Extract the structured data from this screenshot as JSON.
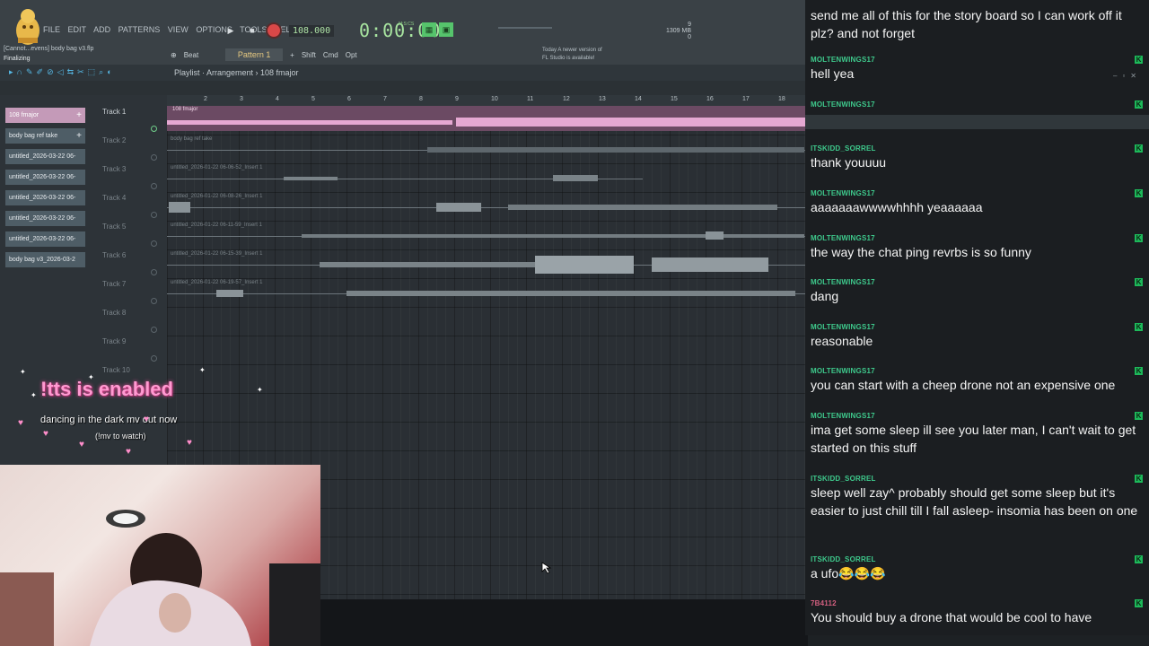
{
  "topbar": {
    "menu": [
      "File",
      "Edit",
      "Add",
      "Patterns",
      "View",
      "Options",
      "Tools",
      "Help"
    ],
    "project_title": "[Cannot...evens] body bag v3.flp",
    "status": "Finalizing",
    "tempo": "108.000",
    "song_time": "0:00:00",
    "song_time_unit": "M:S:CS",
    "memory": "1309 MB",
    "memory_sub": "0",
    "cpu_value": "9",
    "snap": "Beat",
    "pattern": "Pattern 1",
    "shift_label": "Shift",
    "cmd_label": "Cmd",
    "opt_label": "Opt",
    "update_line1": "Today  A newer version of",
    "update_line2": "FL Studio is available!"
  },
  "playlist": {
    "title": "Playlist · Arrangement › 108 fmajor",
    "ruler": [
      "2",
      "3",
      "4",
      "5",
      "6",
      "7",
      "8",
      "9",
      "10",
      "11",
      "12",
      "13",
      "14",
      "15",
      "16",
      "17",
      "18"
    ],
    "picker": [
      {
        "label": "108 fmajor",
        "selected": true
      },
      {
        "label": "body bag ref take",
        "selected": false
      },
      {
        "label": "untitled_2026-03-22 06-",
        "selected": false
      },
      {
        "label": "untitled_2026-03-22 06-",
        "selected": false
      },
      {
        "label": "untitled_2026-03-22 06-",
        "selected": false
      },
      {
        "label": "untitled_2026-03-22 06-",
        "selected": false
      },
      {
        "label": "untitled_2026-03-22 06-",
        "selected": false
      },
      {
        "label": "body bag v3_2026-03-2",
        "selected": false
      }
    ],
    "tracks": [
      "Track 1",
      "Track 2",
      "Track 3",
      "Track 4",
      "Track 5",
      "Track 6",
      "Track 7",
      "Track 8",
      "Track 9",
      "Track 10"
    ],
    "clips": [
      "108 fmajor",
      "body bag ref take",
      "untitled_2026-01-22 06-06-52_Insert 1",
      "untitled_2026-01-22 06-08-26_Insert 1",
      "untitled_2026-01-22 06-11-59_Insert 1",
      "untitled_2026-01-22 06-15-39_Insert 1",
      "untitled_2026-01-22 06-19-57_Insert 1"
    ]
  },
  "overlay": {
    "tts": "!tts is enabled",
    "mv_line": "dancing in the dark mv out now",
    "mv_sub": "(!mv to watch)"
  },
  "chat": {
    "messages": [
      {
        "user": "",
        "text": "send me all of this for the story board so I can work off it plz? and not forget"
      },
      {
        "user": "MOLTENWINGS17",
        "text": "hell yea"
      },
      {
        "user": "MOLTENWINGS17",
        "text": ""
      },
      {
        "user": "ITSKIDD_SORREL",
        "text": "thank youuuu"
      },
      {
        "user": "MOLTENWINGS17",
        "text": "aaaaaaawwwwhhhh yeaaaaaa"
      },
      {
        "user": "MOLTENWINGS17",
        "text": "the way the chat ping revrbs is so funny"
      },
      {
        "user": "MOLTENWINGS17",
        "text": "dang"
      },
      {
        "user": "MOLTENWINGS17",
        "text": "reasonable"
      },
      {
        "user": "MOLTENWINGS17",
        "text": "you can start with a cheep drone not an expensive one"
      },
      {
        "user": "MOLTENWINGS17",
        "text": "ima get some sleep ill see you later man, I can't wait to get started on this stuff"
      },
      {
        "user": "ITSKIDD_SORREL",
        "text": "sleep well zay^ probably should get some sleep but it's easier to just chill till I fall asleep- insomia has been on one"
      },
      {
        "user": "ITSKIDD_SORREL",
        "text": "a ufo😂😂😂"
      },
      {
        "user": "7B4112",
        "text": "You should buy a drone that would be cool to have"
      }
    ]
  },
  "colors": {
    "accent_green": "#3ec98c",
    "clip_pink": "#c49ab8",
    "record_red": "#d94848",
    "tts_pink": "#ff9ad1"
  }
}
